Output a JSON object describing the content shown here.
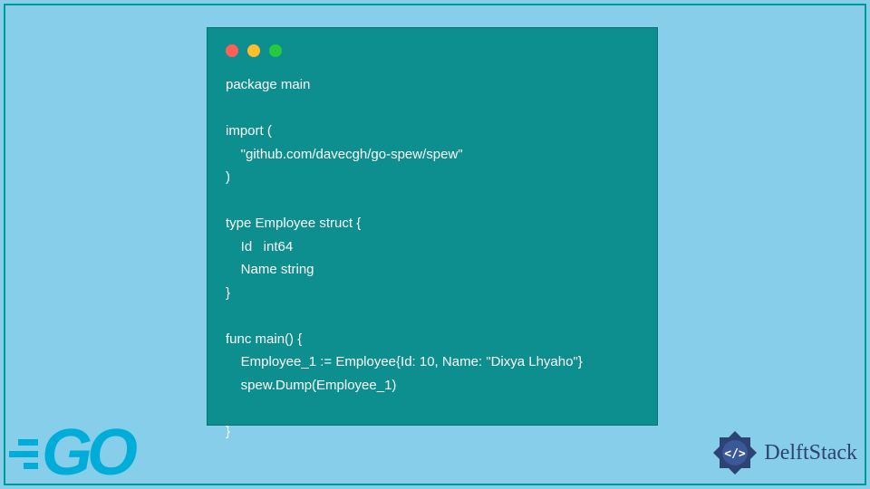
{
  "code": {
    "lines": "package main\n\nimport (\n    \"github.com/davecgh/go-spew/spew\"\n)\n\ntype Employee struct {\n    Id   int64\n    Name string\n}\n\nfunc main() {\n    Employee_1 := Employee{Id: 10, Name: \"Dixya Lhyaho\"}\n    spew.Dump(Employee_1)\n\n}"
  },
  "logos": {
    "go_text": "GO",
    "delft_text": "DelftStack"
  },
  "colors": {
    "bg": "#87CEEB",
    "code_bg": "#0d8f8f",
    "go_color": "#00ADD8",
    "delft_color": "#2d4373"
  }
}
